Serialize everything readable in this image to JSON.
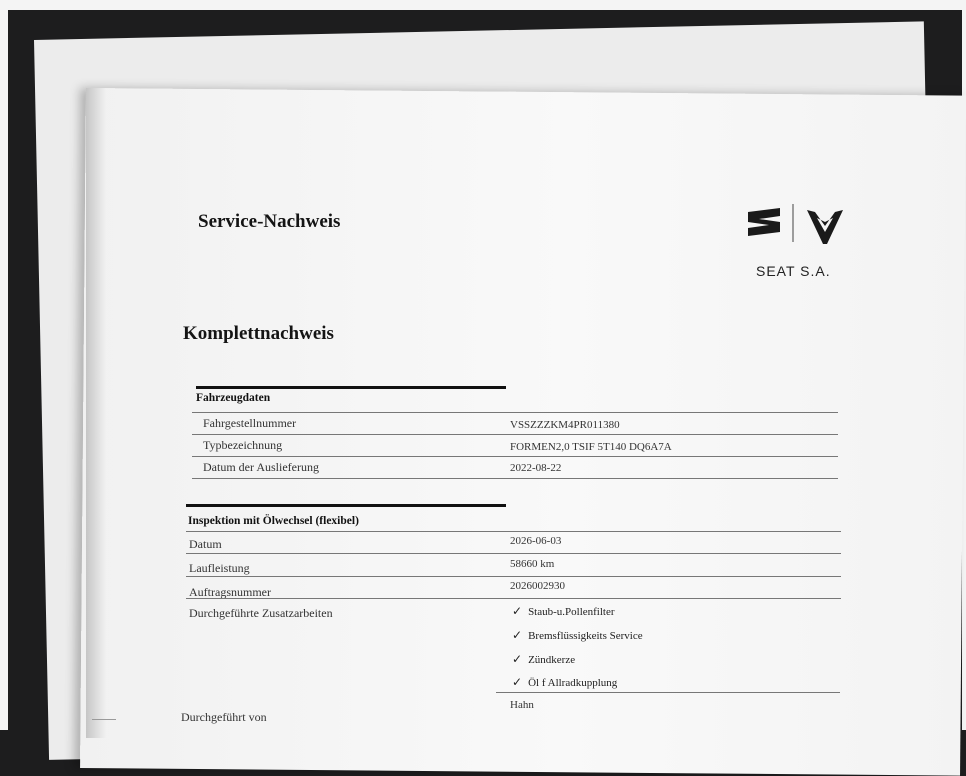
{
  "document": {
    "title": "Service-Nachweis",
    "subtitle": "Komplettnachweis",
    "brand_text": "SEAT S.A.",
    "brand_icons": [
      "seat-logo-icon",
      "cupra-logo-icon"
    ]
  },
  "vehicle_section": {
    "heading": "Fahrzeugdaten",
    "rows": [
      {
        "label": "Fahrgestellnummer",
        "value": "VSSZZZKM4PR011380"
      },
      {
        "label": "Typbezeichnung",
        "value": "FORMEN2,0 TSIF 5T140 DQ6A7A"
      },
      {
        "label": "Datum der Auslieferung",
        "value": "2022-08-22"
      }
    ]
  },
  "inspection_section": {
    "heading": "Inspektion mit Ölwechsel (flexibel)",
    "rows": [
      {
        "label": "Datum",
        "value": "2026-06-03"
      },
      {
        "label": "Laufleistung",
        "value": "58660 km"
      },
      {
        "label": "Auftragsnummer",
        "value": "2026002930"
      }
    ],
    "extra_work_label": "Durchgeführte Zusatzarbeiten",
    "extra_work": [
      "Staub-u.Pollenfilter",
      "Bremsflüssigkeits Service",
      "Zündkerze",
      "Öl f Allradkupplung"
    ],
    "performed_by_label": "Durchgeführt von",
    "performed_by_value": "Hahn"
  },
  "colors": {
    "background": "#1d1d1e",
    "paper": "#f4f4f4",
    "ink": "#141414"
  }
}
